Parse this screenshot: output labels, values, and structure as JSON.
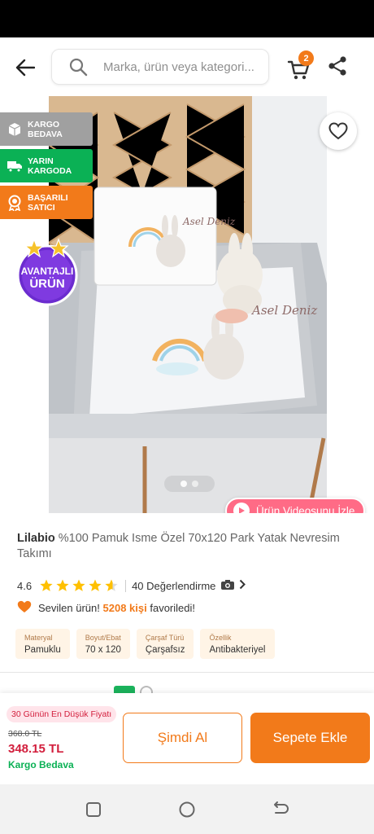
{
  "header": {
    "search_placeholder": "Marka, ürün veya kategori...",
    "cart_count": "2",
    "icons": [
      "back-arrow-icon",
      "search-icon",
      "cart-icon",
      "share-icon"
    ]
  },
  "badges": [
    {
      "label": "KARGO BEDAVA",
      "color": "#a0a0a0",
      "icon": "box-icon"
    },
    {
      "label": "YARIN KARGODA",
      "color": "#0bb155",
      "icon": "truck-icon"
    },
    {
      "label": "BAŞARILI SATICI",
      "color": "#f27a1a",
      "icon": "medal-icon"
    }
  ],
  "avantajli": {
    "line1": "AVANTAJLI",
    "line2": "ÜRÜN"
  },
  "gallery": {
    "image_text_1": "Asel Deniz",
    "image_text_2": "Asel Deniz",
    "current_image": 1,
    "total_images": 2
  },
  "video_button": {
    "label": "Ürün Videosunu İzle"
  },
  "product": {
    "brand": "Lilabio",
    "title": "%100 Pamuk Isme Özel 70x120 Park Yatak Nevresim Takımı",
    "rating": "4.6",
    "rating_value": 4.6,
    "reviews": "40 Değerlendirme",
    "fav_prefix": "Sevilen ürün!",
    "fav_count": "5208 kişi",
    "fav_suffix": "favoriledi!"
  },
  "attributes": [
    {
      "key": "Materyal",
      "value": "Pamuklu"
    },
    {
      "key": "Boyut/Ebat",
      "value": "70 x 120"
    },
    {
      "key": "Çarşaf Türü",
      "value": "Çarşafsız"
    },
    {
      "key": "Özellik",
      "value": "Antibakteriyel"
    }
  ],
  "bottom": {
    "lowest_price_label": "30 Günün En Düşük Fiyatı",
    "old_price": "368.0 TL",
    "new_price": "348.15 TL",
    "shipping": "Kargo Bedava",
    "buy_now": "Şimdi Al",
    "add_to_cart": "Sepete Ekle"
  },
  "colors": {
    "accent": "#f27a1a",
    "price_red": "#d21e3c",
    "green": "#0bb155",
    "video_pink": "#ff6b86"
  }
}
